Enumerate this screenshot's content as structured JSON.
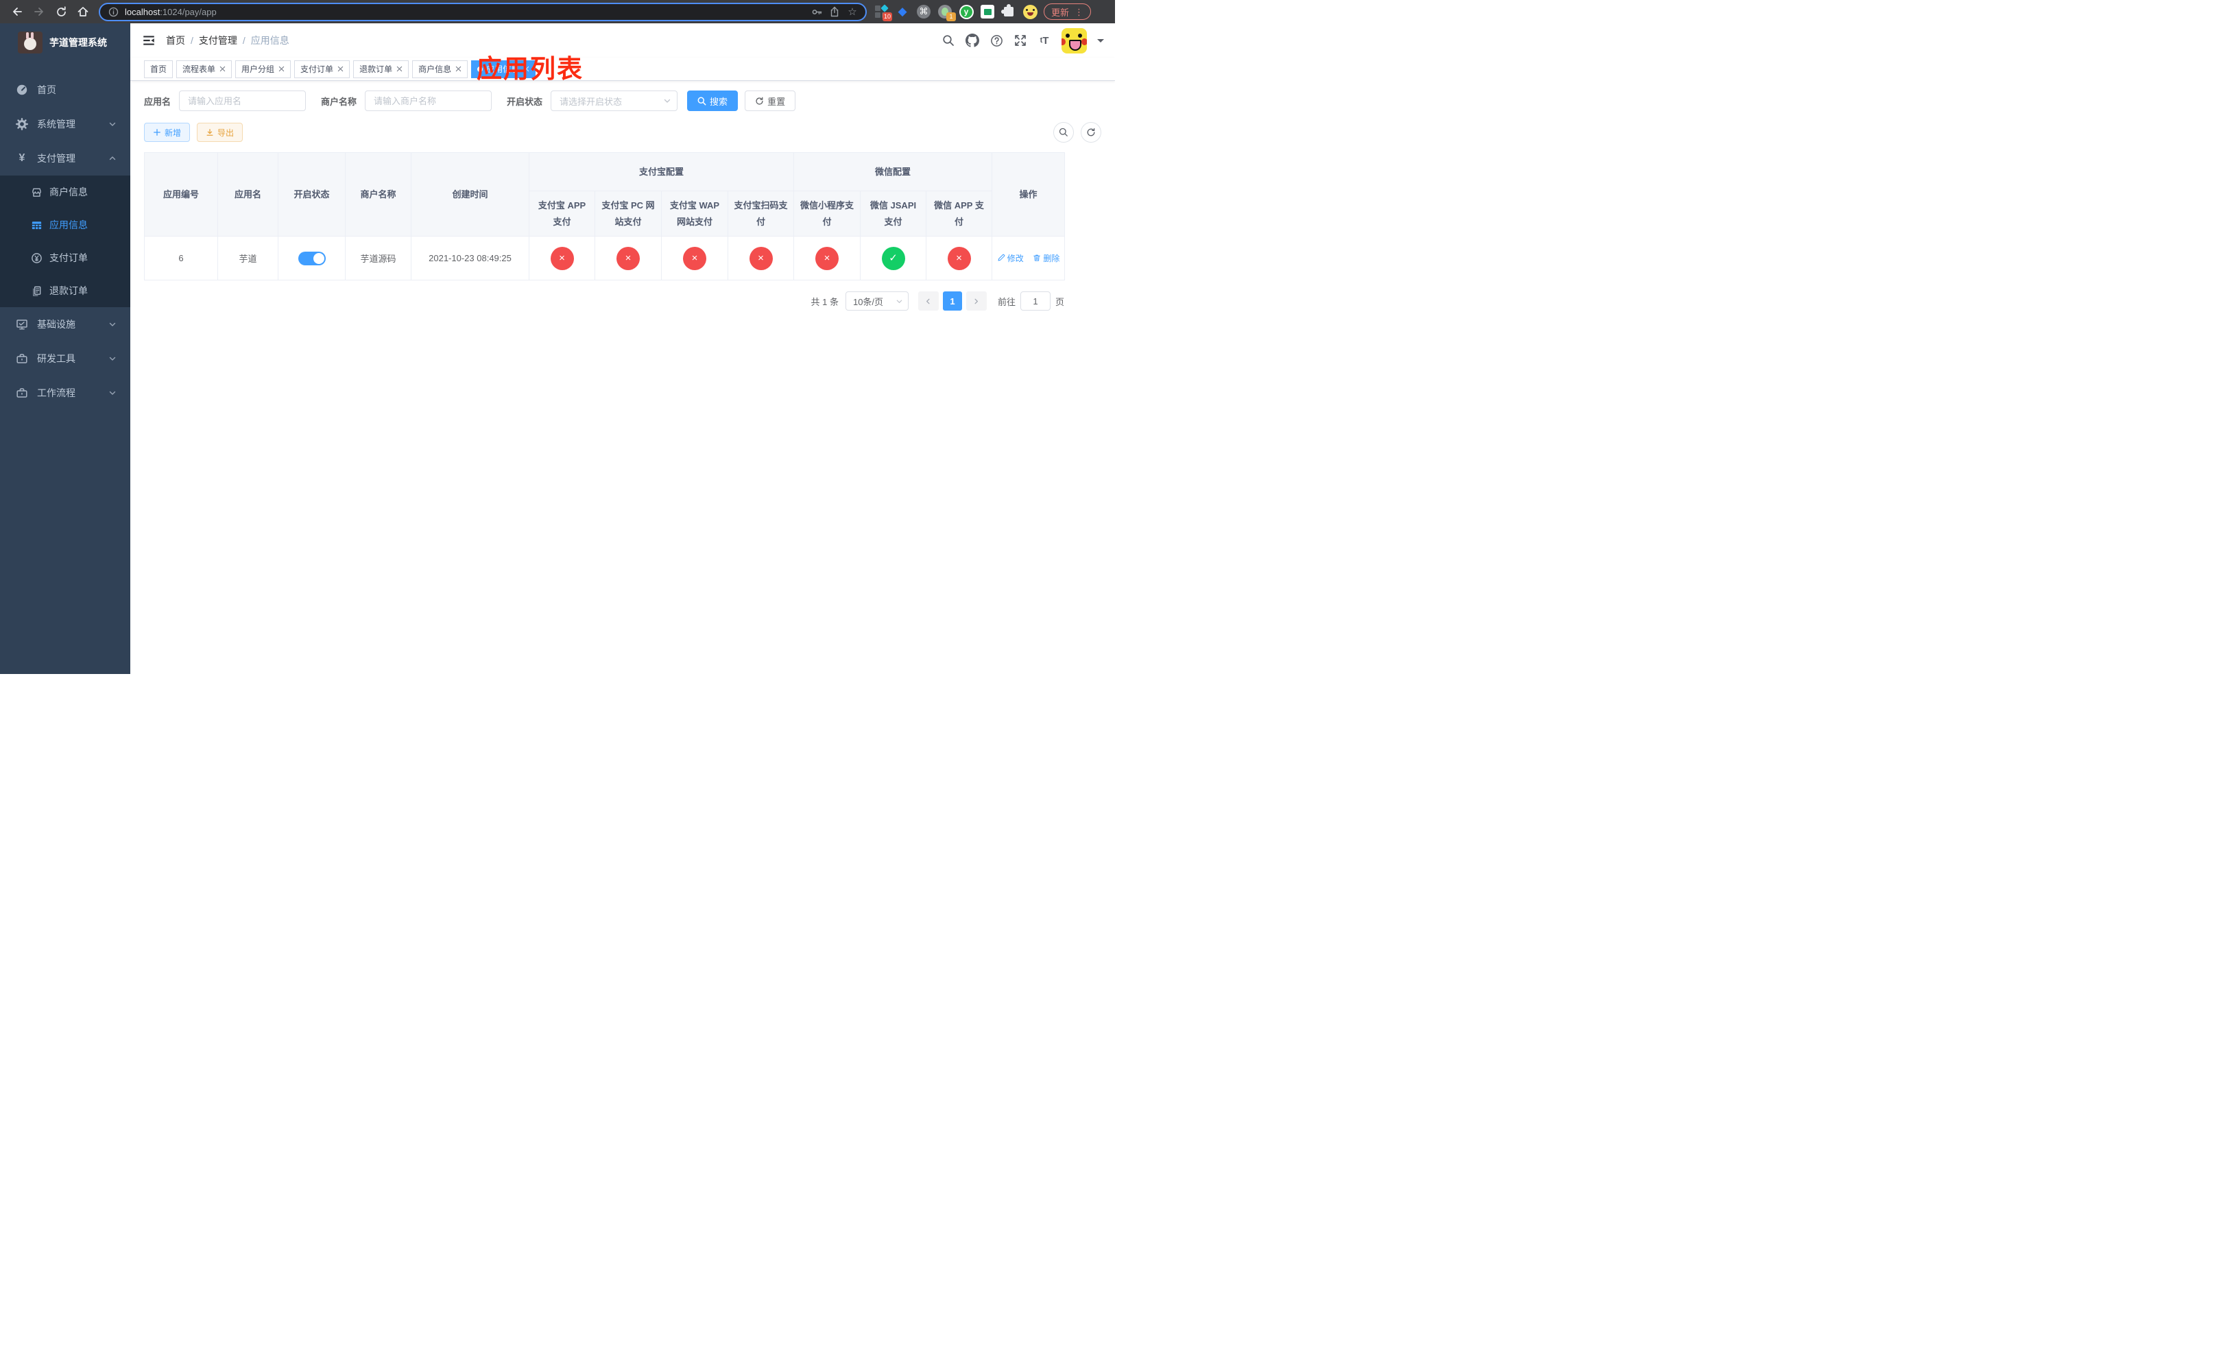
{
  "colors": {
    "accent": "#409eff",
    "success": "#13ce66",
    "danger": "#f34d4d",
    "sidebar_bg": "#304156",
    "submenu_bg": "#1f2d3d"
  },
  "ui": {
    "pass_glyph": "✓",
    "fail_glyph": "×"
  },
  "browser": {
    "url_host": "localhost",
    "url_path": ":1024/pay/app",
    "update_label": "更新",
    "ext_badges": {
      "grid": "10",
      "record": "1"
    },
    "ext_y": "y"
  },
  "sidebar": {
    "title": "芋道管理系统",
    "items": [
      {
        "label": "首页"
      },
      {
        "label": "系统管理"
      },
      {
        "label": "支付管理"
      },
      {
        "label": "商户信息"
      },
      {
        "label": "应用信息"
      },
      {
        "label": "支付订单"
      },
      {
        "label": "退款订单"
      },
      {
        "label": "基础设施"
      },
      {
        "label": "研发工具"
      },
      {
        "label": "工作流程"
      }
    ]
  },
  "navbar": {
    "breadcrumb": [
      {
        "label": "首页"
      },
      {
        "label": "支付管理"
      },
      {
        "label": "应用信息"
      }
    ]
  },
  "annotation": {
    "text": "应用列表"
  },
  "tabs": {
    "items": [
      {
        "label": "首页"
      },
      {
        "label": "流程表单"
      },
      {
        "label": "用户分组"
      },
      {
        "label": "支付订单"
      },
      {
        "label": "退款订单"
      },
      {
        "label": "商户信息"
      },
      {
        "label": "应用信息"
      }
    ]
  },
  "filters": {
    "app_name_label": "应用名",
    "app_name_placeholder": "请输入应用名",
    "merchant_label": "商户名称",
    "merchant_placeholder": "请输入商户名称",
    "status_label": "开启状态",
    "status_placeholder": "请选择开启状态",
    "search_label": "搜索",
    "reset_label": "重置"
  },
  "toolbar": {
    "add_label": "新增",
    "export_label": "导出"
  },
  "table": {
    "group_headers": [
      {
        "label": "支付宝配置"
      },
      {
        "label": "微信配置"
      }
    ],
    "headers": [
      {
        "label": "应用编号"
      },
      {
        "label": "应用名"
      },
      {
        "label": "开启状态"
      },
      {
        "label": "商户名称"
      },
      {
        "label": "创建时间"
      },
      {
        "label": "支付宝 APP 支付"
      },
      {
        "label": "支付宝 PC 网站支付"
      },
      {
        "label": "支付宝 WAP 网站支付"
      },
      {
        "label": "支付宝扫码支付"
      },
      {
        "label": "微信小程序支付"
      },
      {
        "label": "微信 JSAPI 支付"
      },
      {
        "label": "微信 APP 支付"
      },
      {
        "label": "操作"
      }
    ],
    "row": {
      "id": "6",
      "name": "芋道",
      "enabled": true,
      "merchant": "芋道源码",
      "created": "2021-10-23 08:49:25",
      "statuses": [
        false,
        false,
        false,
        false,
        false,
        true,
        false
      ],
      "edit_label": "修改",
      "delete_label": "删除"
    }
  },
  "pagination": {
    "total": "共 1 条",
    "page_size": "10条/页",
    "page": "1",
    "goto_label": "前往",
    "goto_value": "1",
    "unit_label": "页"
  }
}
